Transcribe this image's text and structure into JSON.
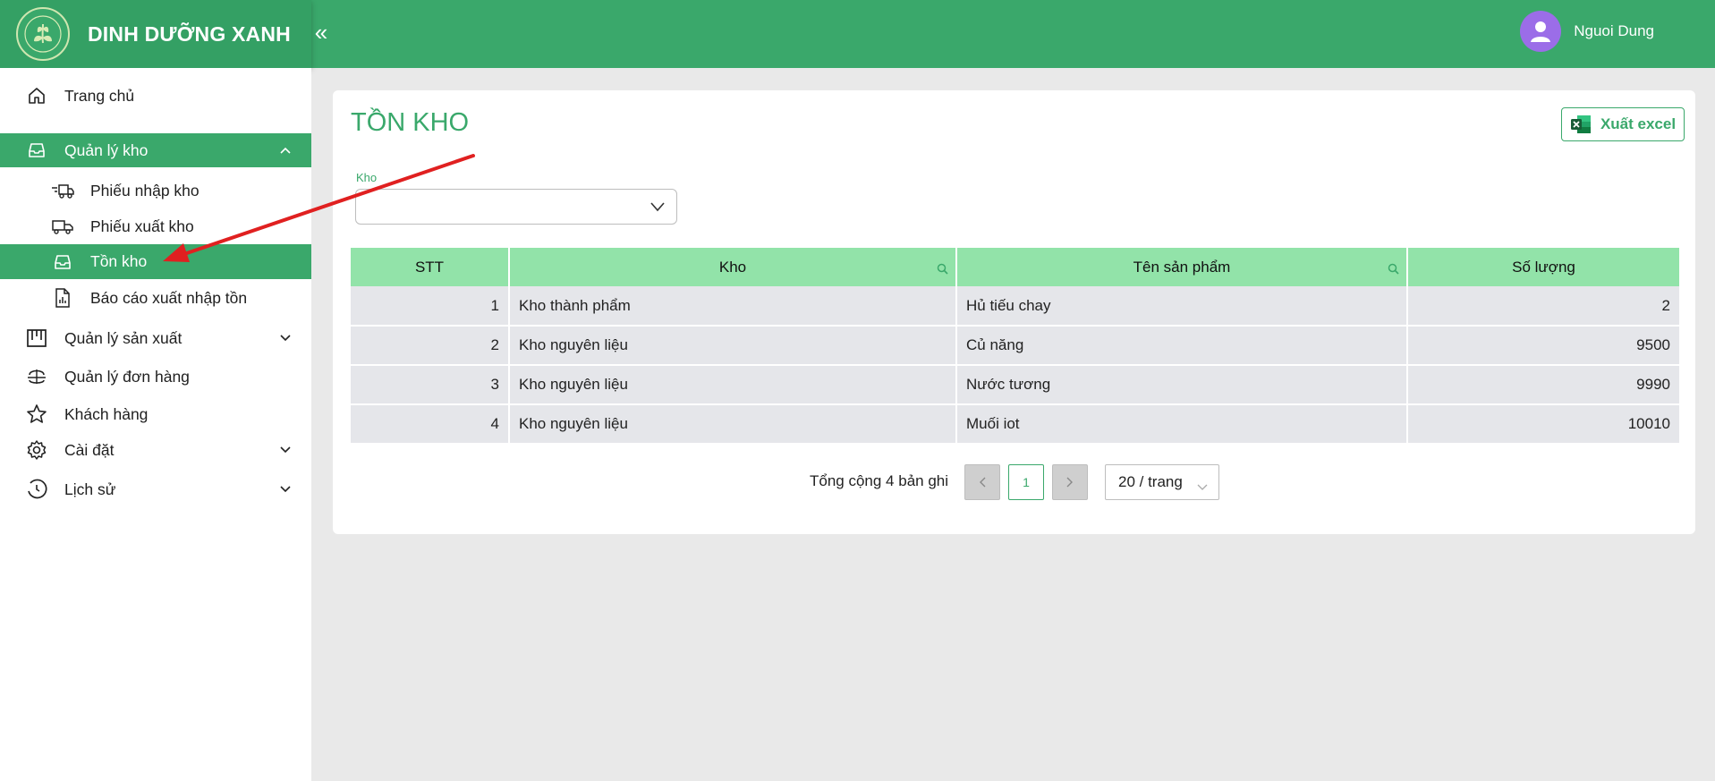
{
  "header": {
    "brand_name": "DINH DƯỠNG XANH",
    "collapse_label": "«",
    "user_name": "Nguoi Dung"
  },
  "sidebar": {
    "items": [
      {
        "label": "Trang chủ",
        "icon": "home-icon"
      },
      {
        "label": "Quản lý kho",
        "icon": "inbox-icon",
        "expanded": true
      },
      {
        "label": "Phiếu nhập kho",
        "icon": "truck-in-icon"
      },
      {
        "label": "Phiếu xuất kho",
        "icon": "truck-icon"
      },
      {
        "label": "Tồn kho",
        "icon": "inbox-icon",
        "active": true
      },
      {
        "label": "Báo cáo xuất nhập tồn",
        "icon": "report-icon"
      },
      {
        "label": "Quản lý sản xuất",
        "icon": "factory-icon"
      },
      {
        "label": "Quản lý đơn hàng",
        "icon": "orders-icon"
      },
      {
        "label": "Khách hàng",
        "icon": "star-icon"
      },
      {
        "label": "Cài đặt",
        "icon": "gear-icon"
      },
      {
        "label": "Lịch sử",
        "icon": "clock-icon"
      }
    ]
  },
  "main": {
    "title": "TỒN KHO",
    "export_label": "Xuất excel",
    "filter": {
      "label": "Kho",
      "value": ""
    },
    "table": {
      "headers": [
        "STT",
        "Kho",
        "Tên sản phẩm",
        "Số lượng"
      ],
      "rows": [
        [
          "1",
          "Kho thành phẩm",
          "Hủ tiếu chay",
          "2"
        ],
        [
          "2",
          "Kho nguyên liệu",
          "Củ năng",
          "9500"
        ],
        [
          "3",
          "Kho nguyên liệu",
          "Nước tương",
          "9990"
        ],
        [
          "4",
          "Kho nguyên liệu",
          "Muối iot",
          "10010"
        ]
      ]
    },
    "pagination": {
      "total_text": "Tổng cộng 4 bản ghi",
      "current_page": "1",
      "page_size": "20 / trang"
    }
  },
  "colors": {
    "primary": "#3aa86b",
    "table_header": "#92e3a9",
    "row_bg": "#e5e6ea",
    "annotation": "#e02020"
  }
}
